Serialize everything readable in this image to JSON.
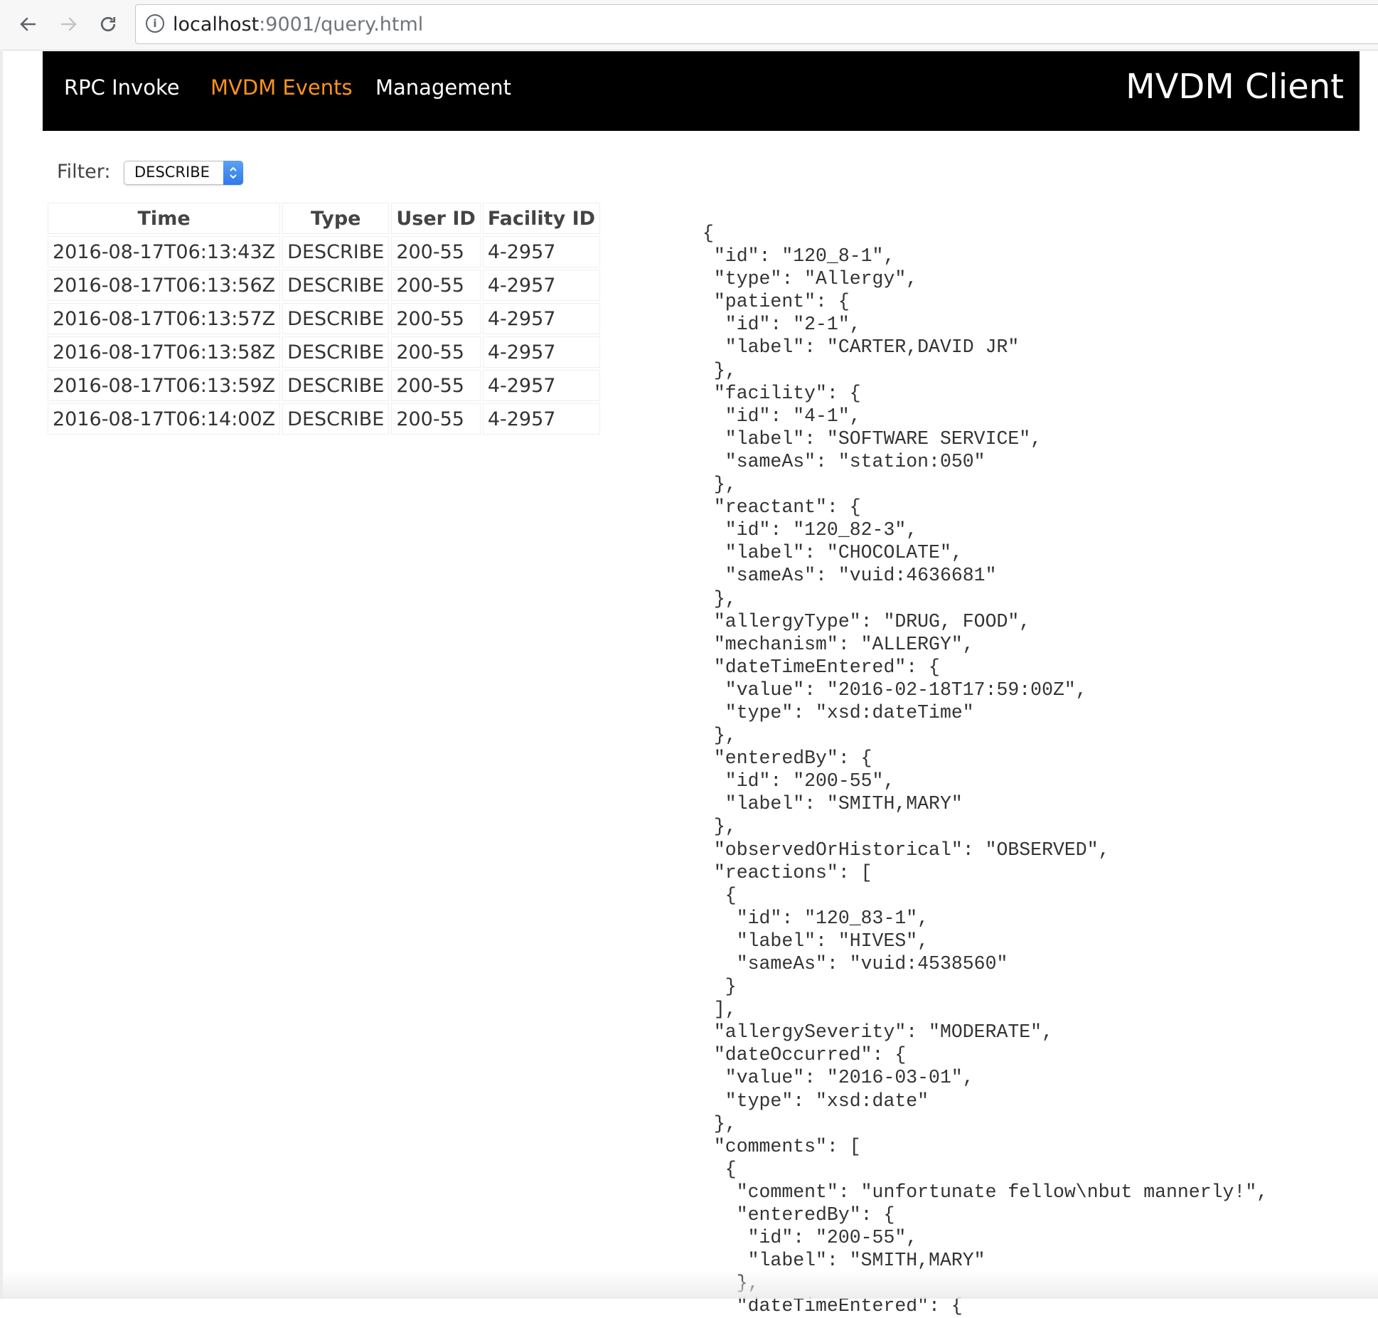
{
  "browser": {
    "url_host": "localhost",
    "url_rest": ":9001/query.html"
  },
  "header": {
    "nav": [
      "RPC Invoke",
      "MVDM Events",
      "Management"
    ],
    "active_nav": "MVDM Events",
    "title": "MVDM Client",
    "active_color": "#f7931e",
    "background": "#000000"
  },
  "filter": {
    "label": "Filter:",
    "value": "DESCRIBE"
  },
  "table": {
    "columns": [
      "Time",
      "Type",
      "User ID",
      "Facility ID"
    ],
    "rows": [
      {
        "time": "2016-08-17T06:13:43Z",
        "type": "DESCRIBE",
        "user": "200-55",
        "facility": "4-2957"
      },
      {
        "time": "2016-08-17T06:13:56Z",
        "type": "DESCRIBE",
        "user": "200-55",
        "facility": "4-2957"
      },
      {
        "time": "2016-08-17T06:13:57Z",
        "type": "DESCRIBE",
        "user": "200-55",
        "facility": "4-2957"
      },
      {
        "time": "2016-08-17T06:13:58Z",
        "type": "DESCRIBE",
        "user": "200-55",
        "facility": "4-2957"
      },
      {
        "time": "2016-08-17T06:13:59Z",
        "type": "DESCRIBE",
        "user": "200-55",
        "facility": "4-2957"
      },
      {
        "time": "2016-08-17T06:14:00Z",
        "type": "DESCRIBE",
        "user": "200-55",
        "facility": "4-2957"
      }
    ]
  },
  "detail_json": "{\n \"id\": \"120_8-1\",\n \"type\": \"Allergy\",\n \"patient\": {\n  \"id\": \"2-1\",\n  \"label\": \"CARTER,DAVID JR\"\n },\n \"facility\": {\n  \"id\": \"4-1\",\n  \"label\": \"SOFTWARE SERVICE\",\n  \"sameAs\": \"station:050\"\n },\n \"reactant\": {\n  \"id\": \"120_82-3\",\n  \"label\": \"CHOCOLATE\",\n  \"sameAs\": \"vuid:4636681\"\n },\n \"allergyType\": \"DRUG, FOOD\",\n \"mechanism\": \"ALLERGY\",\n \"dateTimeEntered\": {\n  \"value\": \"2016-02-18T17:59:00Z\",\n  \"type\": \"xsd:dateTime\"\n },\n \"enteredBy\": {\n  \"id\": \"200-55\",\n  \"label\": \"SMITH,MARY\"\n },\n \"observedOrHistorical\": \"OBSERVED\",\n \"reactions\": [\n  {\n   \"id\": \"120_83-1\",\n   \"label\": \"HIVES\",\n   \"sameAs\": \"vuid:4538560\"\n  }\n ],\n \"allergySeverity\": \"MODERATE\",\n \"dateOccurred\": {\n  \"value\": \"2016-03-01\",\n  \"type\": \"xsd:date\"\n },\n \"comments\": [\n  {\n   \"comment\": \"unfortunate fellow\\nbut mannerly!\",\n   \"enteredBy\": {\n    \"id\": \"200-55\",\n    \"label\": \"SMITH,MARY\"\n   },\n   \"dateTimeEntered\": {"
}
